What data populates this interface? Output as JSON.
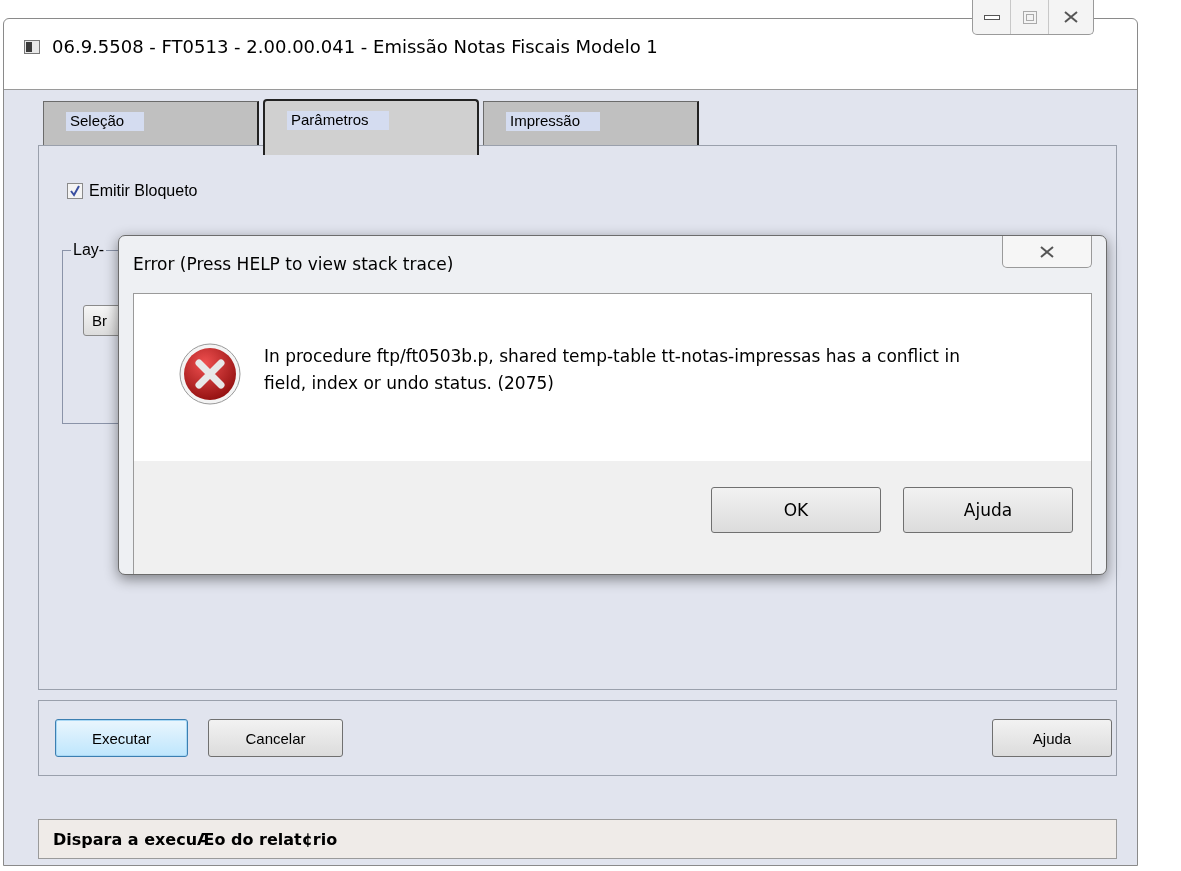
{
  "window": {
    "title": "06.9.5508 - FT0513 - 2.00.00.041 - Emissão Notas Fiscais Modelo 1"
  },
  "tabs": [
    {
      "label": "Seleção",
      "selected": false
    },
    {
      "label": "Parâmetros",
      "selected": true
    },
    {
      "label": "Impressão",
      "selected": false
    }
  ],
  "panel": {
    "checkbox": {
      "label": "Emitir Bloqueto",
      "checked": true
    },
    "group_label": "Lay-",
    "group_button": "Br"
  },
  "buttons": [
    {
      "label": "Executar",
      "kind": "default"
    },
    {
      "label": "Cancelar",
      "kind": "normal"
    },
    {
      "label": "Ajuda",
      "kind": "right"
    }
  ],
  "status_bar": "Dispara a execuÆo do relat¢rio",
  "dialog": {
    "title": "Error (Press HELP to view stack trace)",
    "message": "In procedure ftp/ft0503b.p, shared temp-table tt-notas-impressas has a conflict in field, index or undo status. (2075)",
    "buttons": [
      {
        "label": "OK"
      },
      {
        "label": "Ajuda"
      }
    ]
  }
}
